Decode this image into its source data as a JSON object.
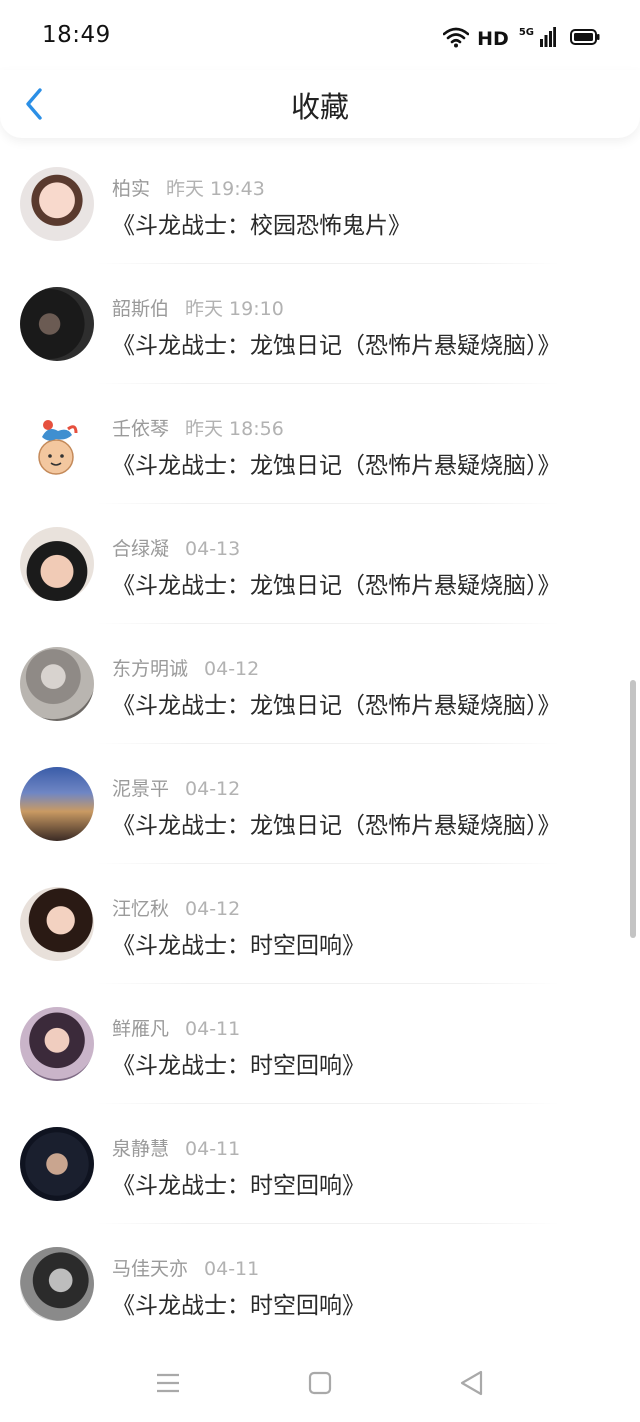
{
  "status_bar": {
    "time": "18:49",
    "network": "HD",
    "signal_label": "5G",
    "icons": [
      "wifi-icon",
      "signal-icon",
      "battery-icon"
    ]
  },
  "header": {
    "title": "收藏",
    "back_icon": "chevron-left-icon"
  },
  "colors": {
    "accent": "#2b8fe6",
    "name_gray": "#9a9a9a",
    "time_gray": "#b2b2b2",
    "scrollbar": "#c4c4c4"
  },
  "favorites": [
    {
      "user": "柏实",
      "time": "昨天 19:43",
      "title": "《斗龙战士：校园恐怖鬼片》"
    },
    {
      "user": "韶斯伯",
      "time": "昨天 19:10",
      "title": "《斗龙战士：龙蚀日记（恐怖片悬疑烧脑）》"
    },
    {
      "user": "壬依琴",
      "time": "昨天 18:56",
      "title": "《斗龙战士：龙蚀日记（恐怖片悬疑烧脑）》"
    },
    {
      "user": "合绿凝",
      "time": "04-13",
      "title": "《斗龙战士：龙蚀日记（恐怖片悬疑烧脑）》"
    },
    {
      "user": "东方明诚",
      "time": "04-12",
      "title": "《斗龙战士：龙蚀日记（恐怖片悬疑烧脑）》"
    },
    {
      "user": "泥景平",
      "time": "04-12",
      "title": "《斗龙战士：龙蚀日记（恐怖片悬疑烧脑）》"
    },
    {
      "user": "汪忆秋",
      "time": "04-12",
      "title": "《斗龙战士：时空回响》"
    },
    {
      "user": "鲜雁凡",
      "time": "04-11",
      "title": "《斗龙战士：时空回响》"
    },
    {
      "user": "泉静慧",
      "time": "04-11",
      "title": "《斗龙战士：时空回响》"
    },
    {
      "user": "马佳天亦",
      "time": "04-11",
      "title": "《斗龙战士：时空回响》"
    }
  ],
  "nav_bar": {
    "icons": [
      "menu-icon",
      "home-icon",
      "back-triangle-icon"
    ]
  }
}
